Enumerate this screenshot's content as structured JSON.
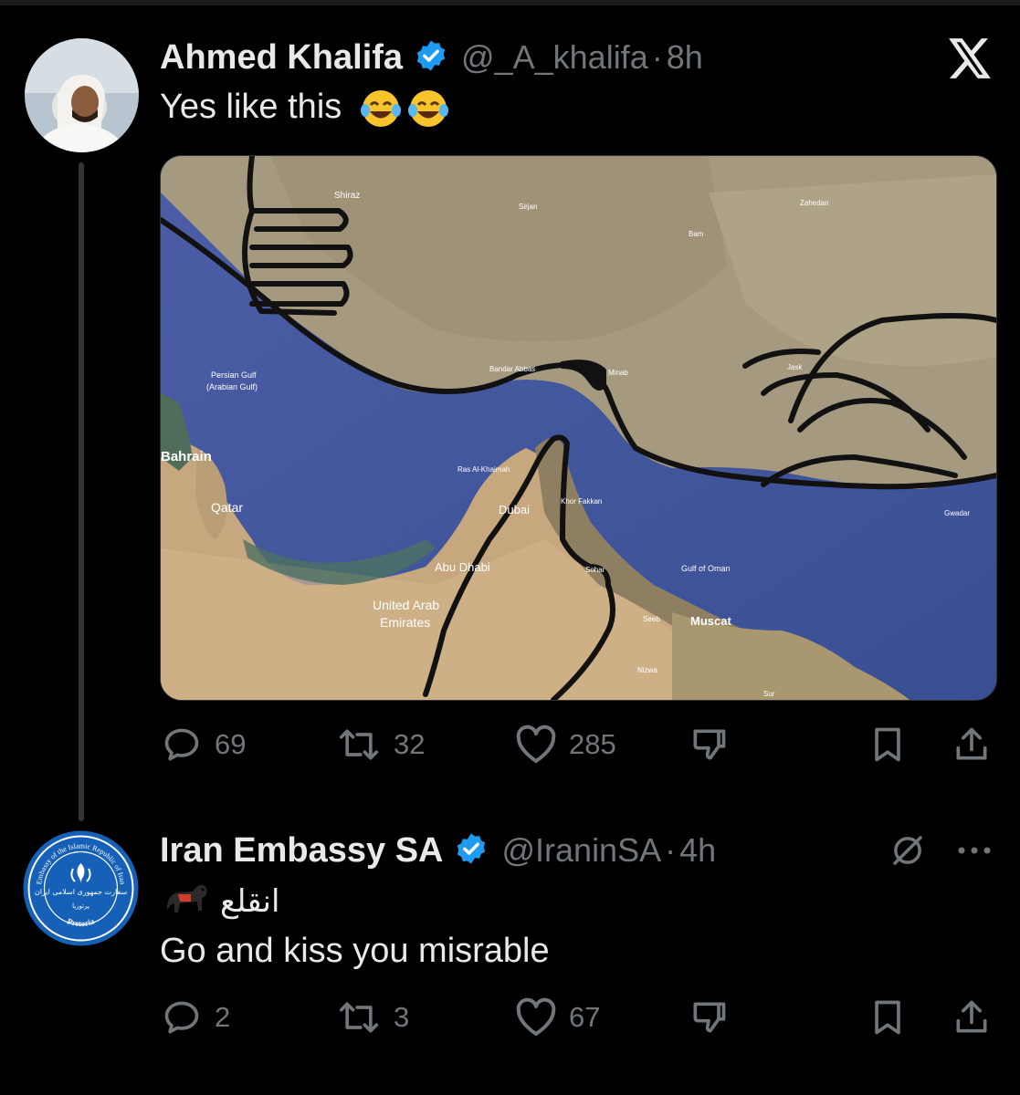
{
  "tweet1": {
    "name": "Ahmed Khalifa",
    "handle": "@_A_khalifa",
    "dot": "·",
    "time": "8h",
    "text": "Yes like this",
    "emoji": "😂😂",
    "map_labels": {
      "bahrain": "Bahrain",
      "qatar": "Qatar",
      "persian_gulf": "Persian Gulf",
      "arabian_gulf": "(Arabian Gulf)",
      "dubai": "Dubai",
      "abu_dhabi": "Abu Dhabi",
      "uae_1": "United Arab",
      "uae_2": "Emirates",
      "muscat": "Muscat",
      "gulf_of_oman": "Gulf of Oman",
      "ras_al_khaimah": "Ras Al-Khaimah",
      "khor_fakkan": "Khor Fakkan",
      "sohar": "Sohar",
      "seeb": "Seeb",
      "nizwa": "Nizwa",
      "sur": "Sur",
      "bandar_abbas": "Bandar Abbas",
      "minab": "Minab",
      "jask": "Jask",
      "bam": "Bam",
      "zahedan": "Zahedan",
      "sirjan": "Sirjan",
      "gwadar": "Gwadar",
      "shiraz": "Shiraz"
    },
    "replies": "69",
    "reposts": "32",
    "likes": "285"
  },
  "tweet2": {
    "name": "Iran Embassy SA",
    "handle": "@IraninSA",
    "dot": "·",
    "time": "4h",
    "arabic": "انقلع",
    "text": "Go and kiss you misrable",
    "replies": "2",
    "reposts": "3",
    "likes": "67",
    "seal_top": "Embassy of the Islamic Republic of Iran",
    "seal_fa": "سفارت جمهوری اسلامی ایران",
    "seal_city_fa": "پرتوریا",
    "seal_bottom": "Pretoria"
  },
  "icons": {
    "x_logo": "x-logo-icon",
    "verified": "verified-badge-icon",
    "reply": "reply-icon",
    "repost": "repost-icon",
    "like": "heart-icon",
    "dislike": "dislike-icon",
    "bookmark": "bookmark-icon",
    "share": "share-icon",
    "grok": "slashed-circle-icon",
    "more": "more-icon"
  },
  "colors": {
    "verified": "#1d9bf0",
    "text": "#e7e9ea",
    "muted": "#71767b",
    "background": "#000000"
  }
}
